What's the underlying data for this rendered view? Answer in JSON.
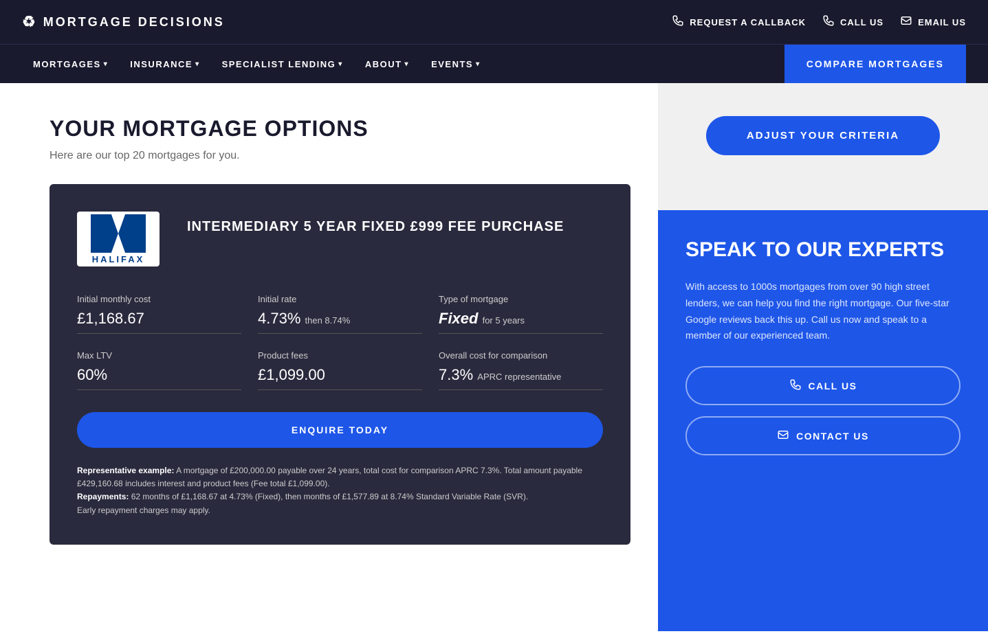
{
  "brand": {
    "logo_icon": "♻",
    "name": "MORTGAGE DECISIONS"
  },
  "header": {
    "actions": [
      {
        "id": "callback",
        "icon": "📞",
        "label": "REQUEST A CALLBACK"
      },
      {
        "id": "call",
        "icon": "📱",
        "label": "CALL US"
      },
      {
        "id": "email",
        "icon": "✉",
        "label": "EMAIL US"
      }
    ]
  },
  "nav": {
    "items": [
      {
        "id": "mortgages",
        "label": "MORTGAGES",
        "has_dropdown": true
      },
      {
        "id": "insurance",
        "label": "INSURANCE",
        "has_dropdown": true
      },
      {
        "id": "specialist",
        "label": "SPECIALIST LENDING",
        "has_dropdown": true
      },
      {
        "id": "about",
        "label": "ABOUT",
        "has_dropdown": true
      },
      {
        "id": "events",
        "label": "EVENTS",
        "has_dropdown": true
      }
    ],
    "cta_label": "COMPARE MORTGAGES"
  },
  "main": {
    "title": "YOUR MORTGAGE OPTIONS",
    "subtitle": "Here are our top 20 mortgages for you."
  },
  "mortgage_card": {
    "lender": "HALIFAX",
    "product_title": "INTERMEDIARY 5 YEAR FIXED £999 FEE PURCHASE",
    "fields": [
      {
        "label": "Initial monthly cost",
        "value": "£1,168.67",
        "id": "monthly_cost"
      },
      {
        "label": "Initial rate",
        "value_main": "4.73%",
        "value_suffix": "then 8.74%",
        "id": "initial_rate"
      },
      {
        "label": "Type of mortgage",
        "value_bold": "Fixed",
        "value_suffix": "for 5 years",
        "id": "type"
      },
      {
        "label": "Max LTV",
        "value": "60%",
        "id": "max_ltv"
      },
      {
        "label": "Product fees",
        "value": "£1,099.00",
        "id": "product_fees"
      },
      {
        "label": "Overall cost for comparison",
        "value_main": "7.3%",
        "value_suffix": "APRC representative",
        "id": "overall_cost"
      }
    ],
    "enquire_label": "ENQUIRE TODAY",
    "rep_example_label": "Representative example:",
    "rep_example_text": " A mortgage of £200,000.00 payable over 24 years, total cost for comparison APRC 7.3%. Total amount payable £429,160.68 includes interest and product fees (Fee total £1,099.00).",
    "repayments_label": "Repayments:",
    "repayments_text": " 62 months of £1,168.67 at 4.73% (Fixed), then months of £1,577.89 at 8.74% Standard Variable Rate (SVR).",
    "early_repayment": "Early repayment charges may apply."
  },
  "sidebar": {
    "adjust_criteria_label": "ADJUST YOUR CRITERIA",
    "speak_title": "SPEAK TO OUR EXPERTS",
    "speak_text": "With access to 1000s mortgages from over 90 high street lenders, we can help you find the right mortgage. Our five-star Google reviews back this up. Call us now and speak to a member of our experienced team.",
    "call_us_label": "CALL US",
    "contact_us_label": "CONTACT US"
  },
  "colors": {
    "primary_blue": "#1e56e8",
    "dark_navy": "#1a1a2e",
    "card_dark": "#2a2a3e"
  }
}
